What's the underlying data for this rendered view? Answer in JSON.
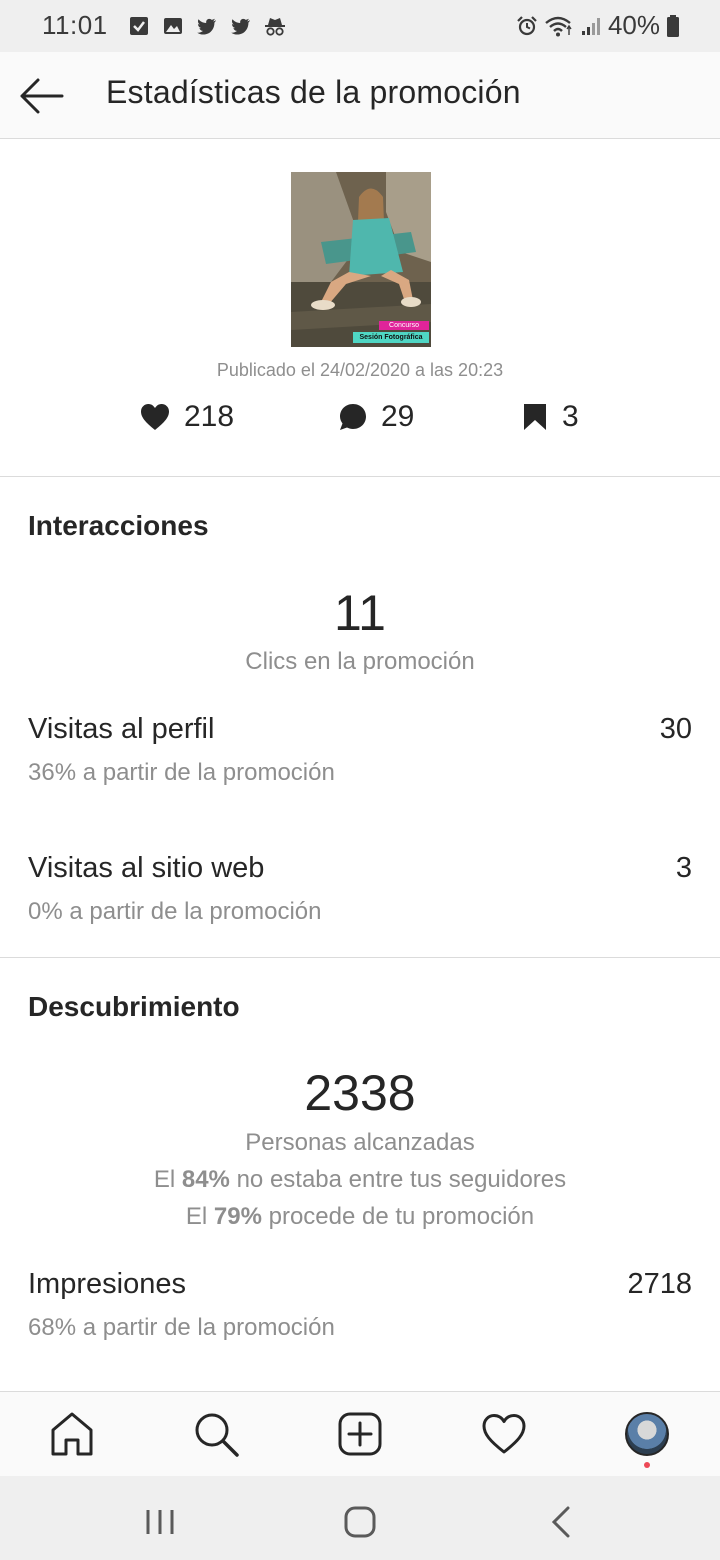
{
  "status_bar": {
    "time": "11:01",
    "battery": "40%",
    "icons_left": [
      "checkbox-icon",
      "image-icon",
      "twitter-icon",
      "twitter-icon",
      "incognito-icon"
    ],
    "icons_right": [
      "alarm-icon",
      "wifi-icon",
      "signal-icon",
      "battery-icon"
    ]
  },
  "header": {
    "title": "Estadísticas de la promoción",
    "back_icon": "arrow-left-icon"
  },
  "post": {
    "thumbnail_label_1": "Concurso",
    "thumbnail_label_2": "Sesión Fotográfica",
    "published": "Publicado el 24/02/2020 a las 20:23",
    "likes": "218",
    "comments": "29",
    "saves": "3"
  },
  "interactions": {
    "title": "Interacciones",
    "clicks_value": "11",
    "clicks_label": "Clics en la promoción",
    "profile_visits": {
      "label": "Visitas al perfil",
      "value": "30",
      "sub": "36% a partir de la promoción"
    },
    "website_visits": {
      "label": "Visitas al sitio web",
      "value": "3",
      "sub": "0% a partir de la promoción"
    }
  },
  "discovery": {
    "title": "Descubrimiento",
    "reach_value": "2338",
    "reach_label": "Personas alcanzadas",
    "non_followers_prefix": "El ",
    "non_followers_pct": "84%",
    "non_followers_suffix": " no estaba entre tus seguidores",
    "promo_prefix": "El ",
    "promo_pct": "79%",
    "promo_suffix": " procede de tu promoción",
    "impressions": {
      "label": "Impresiones",
      "value": "2718",
      "sub": "68% a partir de la promoción"
    }
  },
  "bottom_nav": {
    "items": [
      "home-icon",
      "search-icon",
      "add-post-icon",
      "activity-heart-icon",
      "profile-avatar"
    ]
  },
  "system_nav": {
    "items": [
      "recent-apps-icon",
      "home-circle-icon",
      "back-chevron-icon"
    ]
  },
  "colors": {
    "text_primary": "#262626",
    "text_secondary": "#8e8e8e",
    "divider": "#dbdbdb",
    "notification_dot": "#ed4956"
  }
}
